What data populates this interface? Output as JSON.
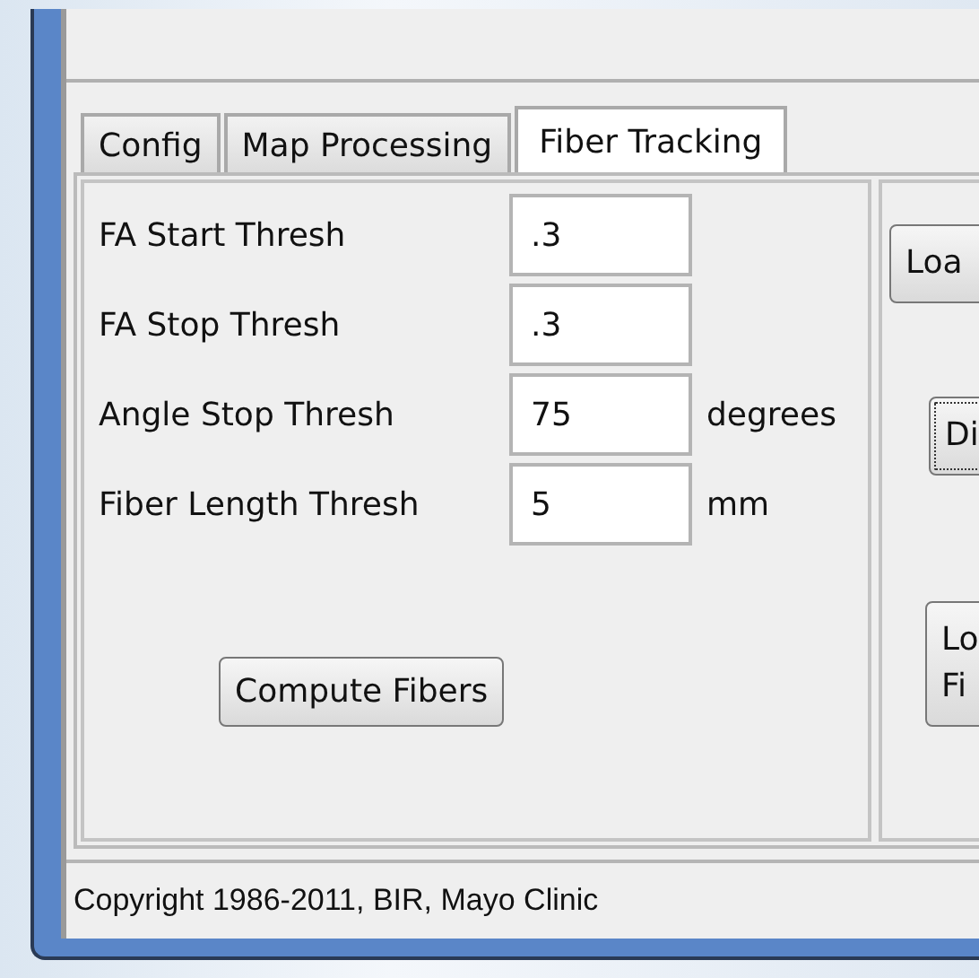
{
  "tabs": [
    {
      "label": "Config",
      "selected": false
    },
    {
      "label": "Map Processing",
      "selected": false
    },
    {
      "label": "Fiber Tracking",
      "selected": true
    }
  ],
  "fields": [
    {
      "label": "FA Start Thresh",
      "value": ".3"
    },
    {
      "label": "FA Stop Thresh",
      "value": ".3"
    },
    {
      "label": "Angle Stop Thresh",
      "value": "75",
      "unit": "degrees"
    },
    {
      "label": "Fiber Length Thresh",
      "value": "5",
      "unit": "mm"
    }
  ],
  "compute_button": "Compute Fibers",
  "side_buttons": [
    {
      "lines": [
        "Loa"
      ],
      "focused": false
    },
    {
      "lines": [
        "Di"
      ],
      "focused": true
    },
    {
      "lines": [
        "Lo",
        "Fi"
      ],
      "focused": false
    }
  ],
  "status_bar": "Copyright 1986-2011, BIR, Mayo Clinic"
}
